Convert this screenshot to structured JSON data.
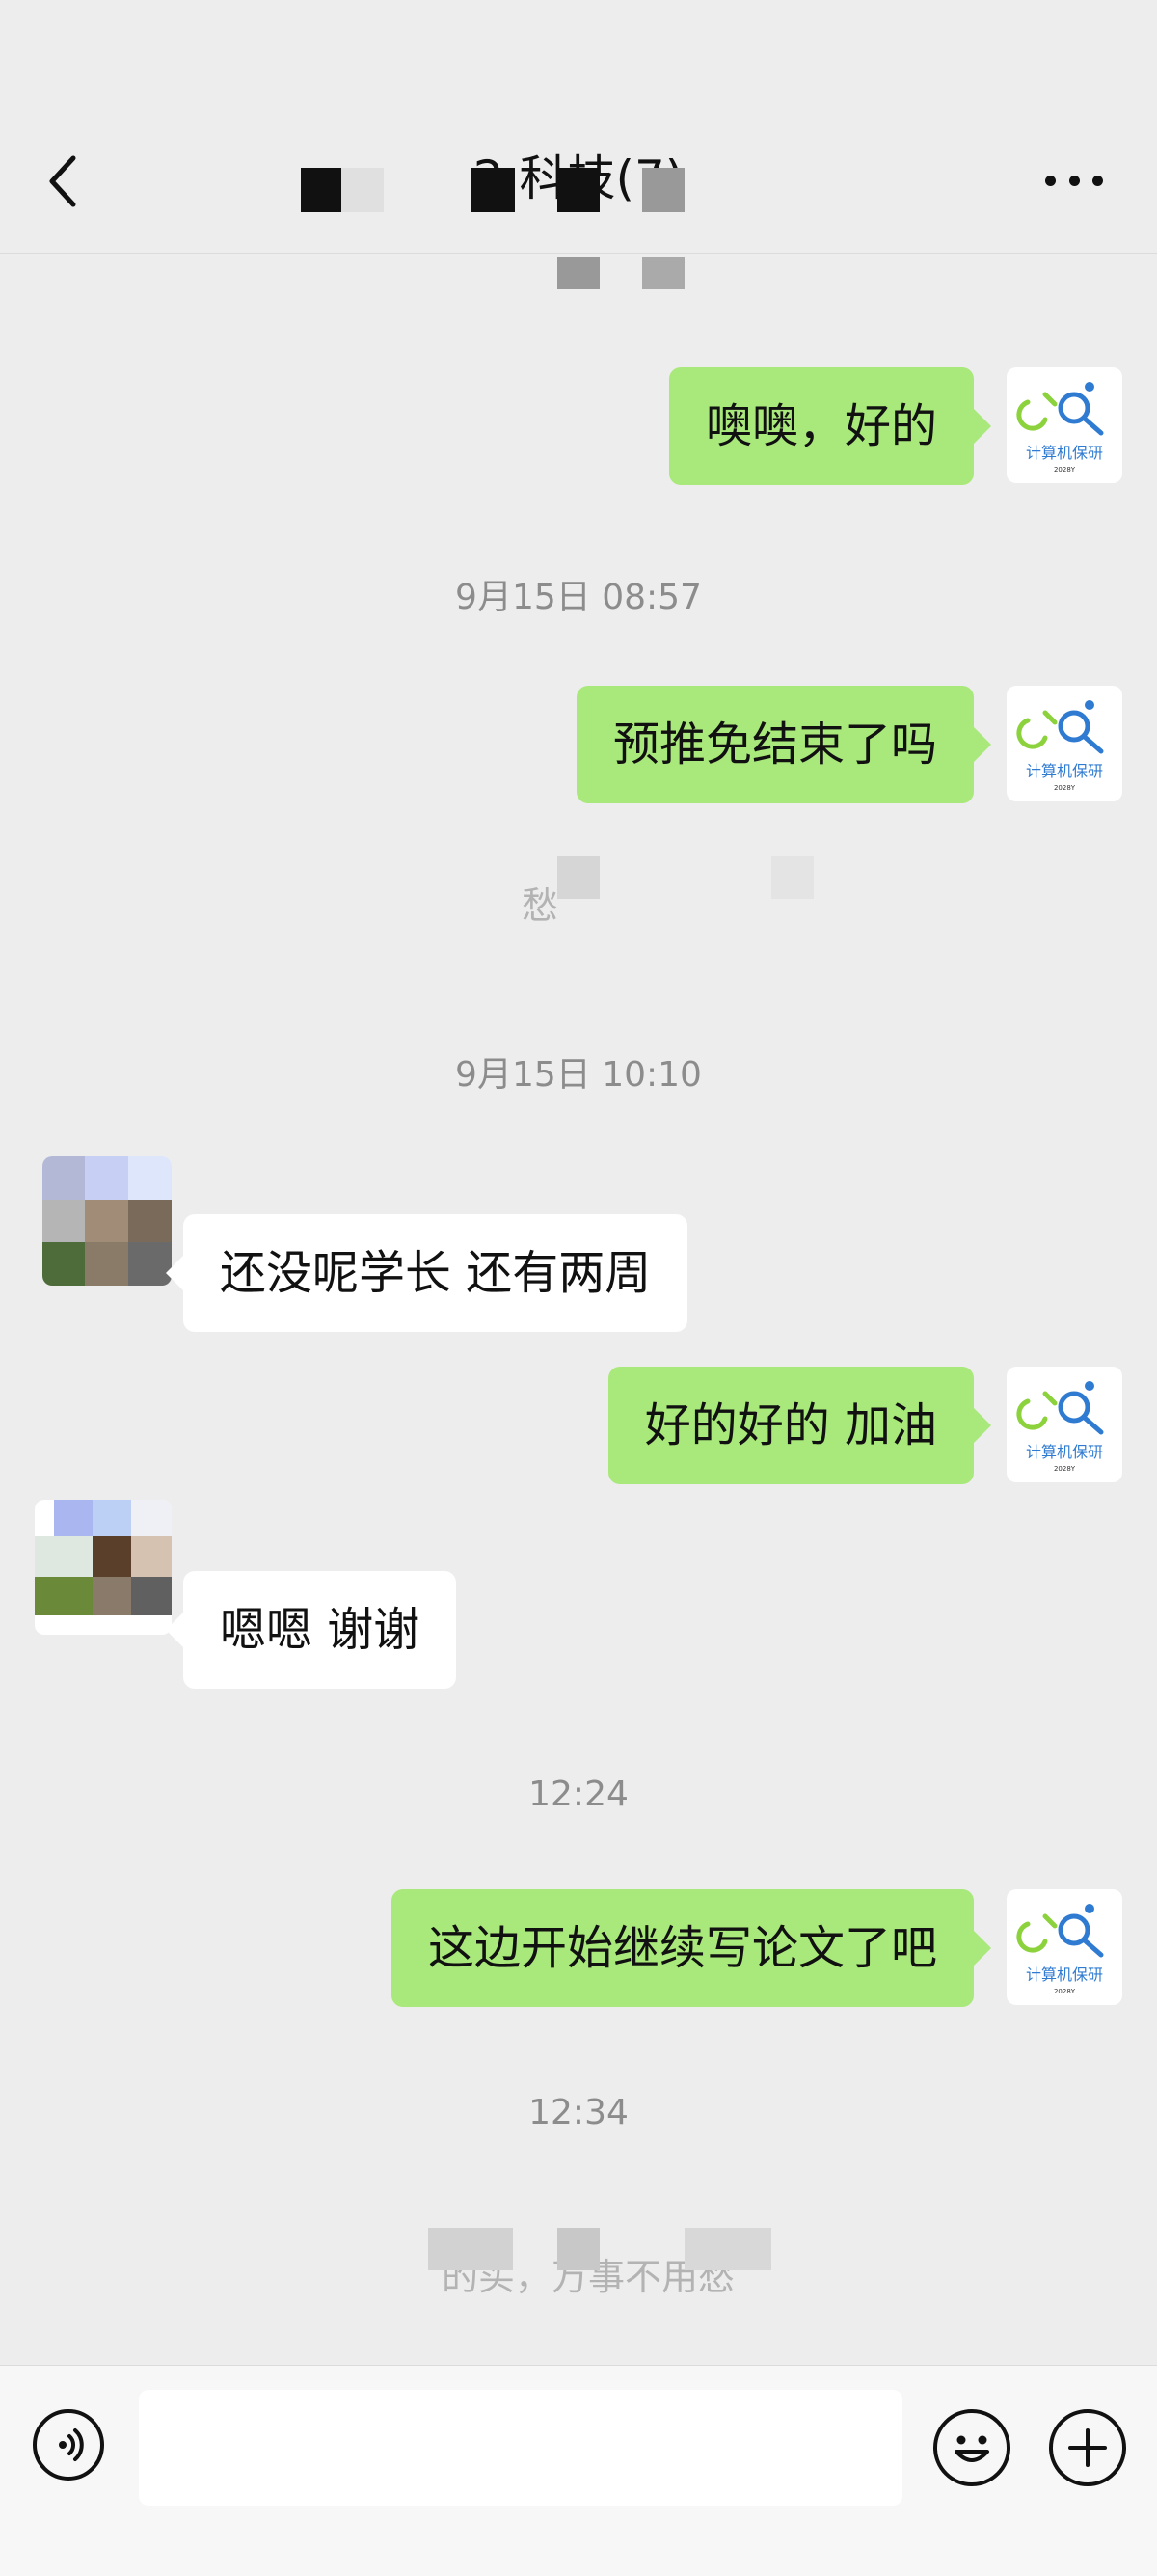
{
  "header": {
    "title": "2         科技(7)"
  },
  "messages": {
    "m1": "噢噢，好的",
    "t1": "9月15日 08:57",
    "m2": "预推免结束了吗",
    "sys1": "    愁",
    "t2": "9月15日 10:10",
    "m3": "还没呢学长 还有两周",
    "m4": "好的好的 加油",
    "m5": "嗯嗯 谢谢",
    "t3": "12:24",
    "m6": "这边开始继续写论文了吧",
    "t4": "12:34",
    "sys2": "           的买，万事不用愁"
  },
  "avatar_me": {
    "label": "计算机保研",
    "sub": "2028Y"
  },
  "colors": {
    "my_bubble": "#a9e87a",
    "their_bubble": "#ffffff",
    "background": "#ededed"
  },
  "icons": [
    "back-icon",
    "more-icon",
    "voice-icon",
    "emoji-icon",
    "plus-icon"
  ]
}
